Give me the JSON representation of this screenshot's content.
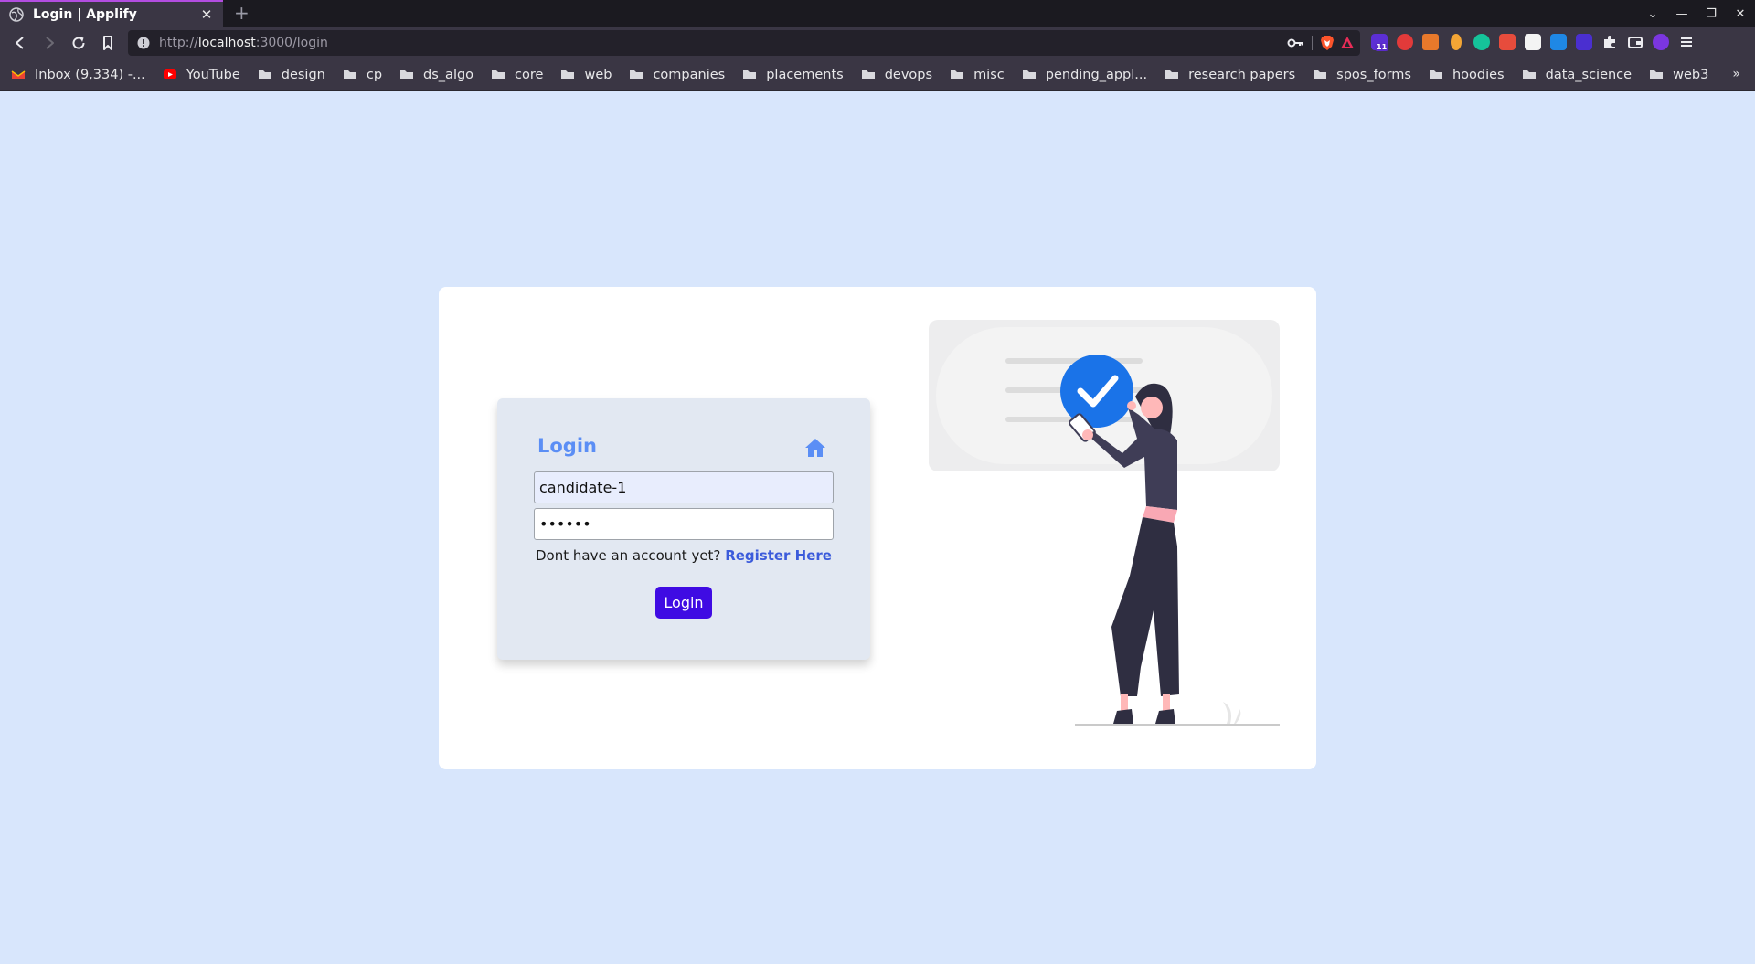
{
  "browser": {
    "tab_title": "Login | Applify",
    "tab_close": "✕",
    "new_tab": "+",
    "url_scheme": "http://",
    "url_host": "localhost",
    "url_path": ":3000/login",
    "window_controls": [
      "⌄",
      "—",
      "❐",
      "✕"
    ],
    "bookmarks_more": "»",
    "bookmarks": [
      {
        "label": "Inbox (9,334) -...",
        "icon": "gmail-icon"
      },
      {
        "label": "YouTube",
        "icon": "youtube-icon"
      },
      {
        "label": "design",
        "icon": "folder-icon"
      },
      {
        "label": "cp",
        "icon": "folder-icon"
      },
      {
        "label": "ds_algo",
        "icon": "folder-icon"
      },
      {
        "label": "core",
        "icon": "folder-icon"
      },
      {
        "label": "web",
        "icon": "folder-icon"
      },
      {
        "label": "companies",
        "icon": "folder-icon"
      },
      {
        "label": "placements",
        "icon": "folder-icon"
      },
      {
        "label": "devops",
        "icon": "folder-icon"
      },
      {
        "label": "misc",
        "icon": "folder-icon"
      },
      {
        "label": "pending_appl...",
        "icon": "folder-icon"
      },
      {
        "label": "research papers",
        "icon": "folder-icon"
      },
      {
        "label": "spos_forms",
        "icon": "folder-icon"
      },
      {
        "label": "hoodies",
        "icon": "folder-icon"
      },
      {
        "label": "data_science",
        "icon": "folder-icon"
      },
      {
        "label": "web3",
        "icon": "folder-icon"
      }
    ],
    "extension_badge": "11"
  },
  "login": {
    "title": "Login",
    "username_value": "candidate-1",
    "password_value": "••••••",
    "register_prompt": "Dont have an account yet?",
    "register_link": "Register Here",
    "submit_label": "Login"
  },
  "colors": {
    "page_bg": "#d8e6fc",
    "accent": "#5b8ef5",
    "button": "#3f0be3",
    "link": "#3b5bdb",
    "check_circle": "#1a73e8"
  }
}
